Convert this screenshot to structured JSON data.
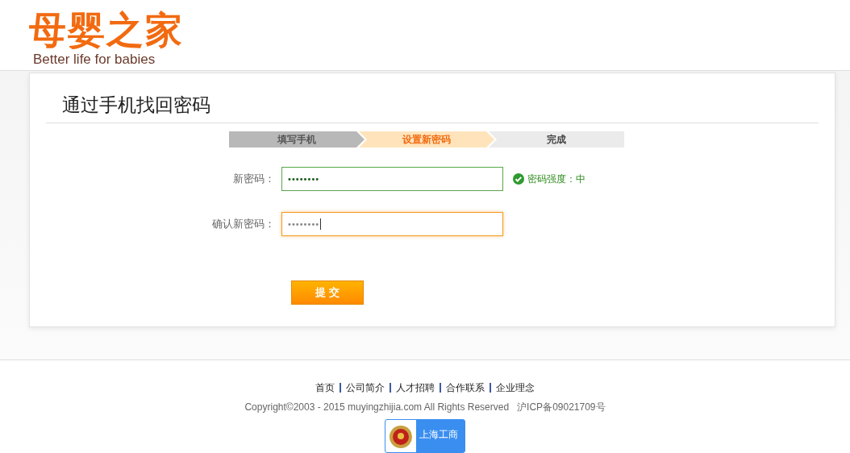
{
  "header": {
    "logo_text": "母婴之家",
    "slogan": "Better life for babies"
  },
  "page_title": "通过手机找回密码",
  "steps": [
    {
      "label": "填写手机",
      "selected": false,
      "done": true
    },
    {
      "label": "设置新密码",
      "selected": true,
      "done": false
    },
    {
      "label": "完成",
      "selected": false,
      "done": false
    }
  ],
  "fields": [
    {
      "label": "新密码：",
      "value": "••••••••",
      "focused": false,
      "valid": true,
      "hint": "密码强度：中"
    },
    {
      "label": "确认新密码：",
      "value": "••••••••",
      "focused": true,
      "valid": false
    }
  ],
  "submit_button": "提 交",
  "footer": {
    "links": [
      "首页",
      "公司简介",
      "人才招聘",
      "合作联系",
      "企业理念"
    ],
    "copyright": "Copyright©2003 - 2015 muyingzhijia.com All Rights Reserved   沪ICP备09021709号",
    "badge": "上海工商"
  }
}
